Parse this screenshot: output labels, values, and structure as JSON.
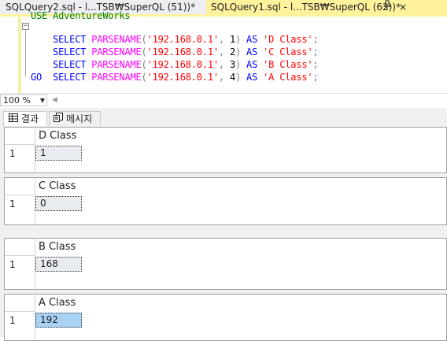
{
  "tabs": [
    {
      "label": "SQLQuery2.sql - l...TSB₩SuperQL (51))*",
      "active": false
    },
    {
      "label": "SQLQuery1.sql - l...TSB₩SuperQL (62))*",
      "active": true,
      "pin_glyph": "📌",
      "close_glyph": "×"
    }
  ],
  "editor": {
    "cut_line": "USE AdventureWorks",
    "collapse_glyph": "−",
    "lines": [
      {
        "kw1": "SELECT",
        "fn": "PARSENAME",
        "open": "(",
        "str1": "'192.168.0.1'",
        "comma": ",",
        "num": "1",
        "close": ")",
        "kw2": "AS",
        "str2": "'D Class'",
        "semi": ";"
      },
      {
        "kw1": "SELECT",
        "fn": "PARSENAME",
        "open": "(",
        "str1": "'192.168.0.1'",
        "comma": ",",
        "num": "2",
        "close": ")",
        "kw2": "AS",
        "str2": "'C Class'",
        "semi": ";"
      },
      {
        "kw1": "SELECT",
        "fn": "PARSENAME",
        "open": "(",
        "str1": "'192.168.0.1'",
        "comma": ",",
        "num": "3",
        "close": ")",
        "kw2": "AS",
        "str2": "'B Class'",
        "semi": ";"
      },
      {
        "kw1": "SELECT",
        "fn": "PARSENAME",
        "open": "(",
        "str1": "'192.168.0.1'",
        "comma": ",",
        "num": "4",
        "close": ")",
        "kw2": "AS",
        "str2": "'A Class'",
        "semi": ";"
      }
    ],
    "go": "GO"
  },
  "zoom": {
    "value": "100 %",
    "dropdown_glyph": "▼",
    "scroll_glyph": "◀"
  },
  "result_tabs": {
    "results_label": "결과",
    "messages_label": "메시지"
  },
  "grids": [
    {
      "header": "D Class",
      "row_number": "1",
      "value": "1",
      "selected": false
    },
    {
      "header": "C Class",
      "row_number": "1",
      "value": "0",
      "selected": false
    },
    {
      "header": "B Class",
      "row_number": "1",
      "value": "168",
      "selected": false
    },
    {
      "header": "A Class",
      "row_number": "1",
      "value": "192",
      "selected": true
    }
  ],
  "colors": {
    "active_tab": "#fff29d",
    "selection": "#a8d2f4",
    "keyword": "#0000ff",
    "function": "#ff00ff",
    "string": "#ff0000"
  }
}
